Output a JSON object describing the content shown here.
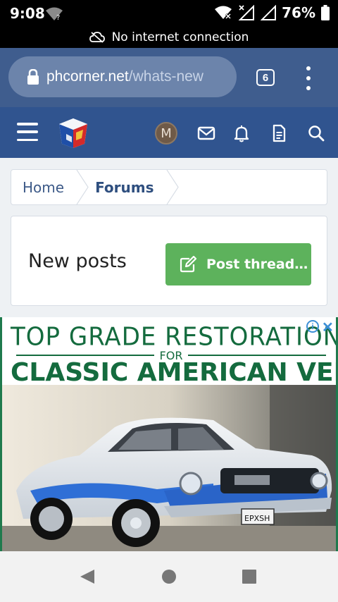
{
  "status_bar": {
    "time": "9:08",
    "battery_percent": "76%",
    "wifi_status_icon": "wifi-question-icon",
    "signal_icons": [
      "wifi-off-icon",
      "signal-x-icon",
      "signal-icon",
      "battery-icon"
    ]
  },
  "network_banner": {
    "text": "No internet connection",
    "icon": "cloud-off-icon"
  },
  "browser": {
    "url_domain": "phcorner.net",
    "url_path": "/whats-new",
    "tab_count": "6",
    "lock_icon": "lock-icon",
    "menu_icon": "more-vert-icon"
  },
  "site_header": {
    "avatar_letter": "M",
    "icons": [
      "menu-icon",
      "logo",
      "envelope-icon",
      "bell-icon",
      "document-icon",
      "search-icon"
    ],
    "accent_color": "#30548f"
  },
  "breadcrumb": {
    "items": [
      {
        "label": "Home"
      },
      {
        "label": "Forums"
      }
    ]
  },
  "page": {
    "title": "New posts",
    "post_button_label": "Post thread…",
    "post_button_color": "#5db25c"
  },
  "ad": {
    "line1": "TOP GRADE RESTORATION PARTS",
    "line_for": "FOR",
    "line2": "CLASSIC AMERICAN VEHICLES",
    "plate_text": "EPXSH",
    "text_color": "#146b3e"
  },
  "system_nav": {
    "buttons": [
      "back-icon",
      "home-icon",
      "recents-icon"
    ]
  }
}
